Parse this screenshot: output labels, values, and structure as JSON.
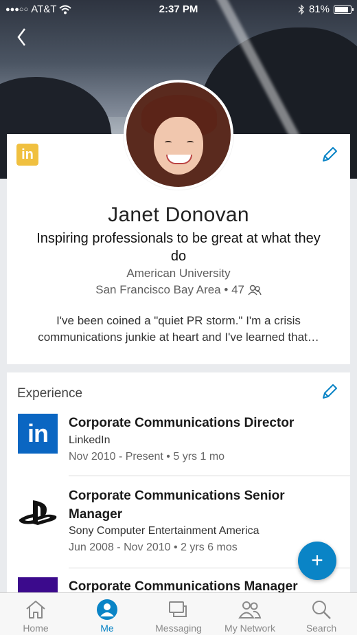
{
  "status_bar": {
    "signal_dots": "●●●○○",
    "carrier": "AT&T",
    "time": "2:37 PM",
    "battery_percent": "81%",
    "battery_level": 0.81
  },
  "profile": {
    "badge_text": "in",
    "name": "Janet Donovan",
    "headline": "Inspiring professionals to be great at what they do",
    "school": "American University",
    "location": "San Francisco Bay Area",
    "connections": "47",
    "summary": "I've been coined a \"quiet PR storm.\" I'm a crisis communications junkie at heart and I've learned that…"
  },
  "experience": {
    "title": "Experience",
    "items": [
      {
        "role": "Corporate Communications Director",
        "company": "LinkedIn",
        "start": "Nov 2010",
        "end": "Present",
        "duration": "5 yrs 1 mo",
        "logo": "linkedin-logo",
        "logo_text": "in"
      },
      {
        "role": "Corporate Communications Senior Manager",
        "company": "Sony Computer Entertainment America",
        "start": "Jun 2008",
        "end": "Nov 2010",
        "duration": "2 yrs 6 mos",
        "logo": "playstation-logo"
      },
      {
        "role": "Corporate Communications Manager",
        "logo": "purple-company-logo"
      }
    ]
  },
  "fab": {
    "label": "+"
  },
  "tabs": [
    {
      "label": "Home",
      "icon": "home-icon"
    },
    {
      "label": "Me",
      "icon": "me-icon",
      "active": true
    },
    {
      "label": "Messaging",
      "icon": "messaging-icon"
    },
    {
      "label": "My Network",
      "icon": "network-icon"
    },
    {
      "label": "Search",
      "icon": "search-icon"
    }
  ],
  "colors": {
    "accent": "#0a84c6",
    "linkedin_blue": "#0a66c2",
    "badge_gold": "#f0c040"
  }
}
